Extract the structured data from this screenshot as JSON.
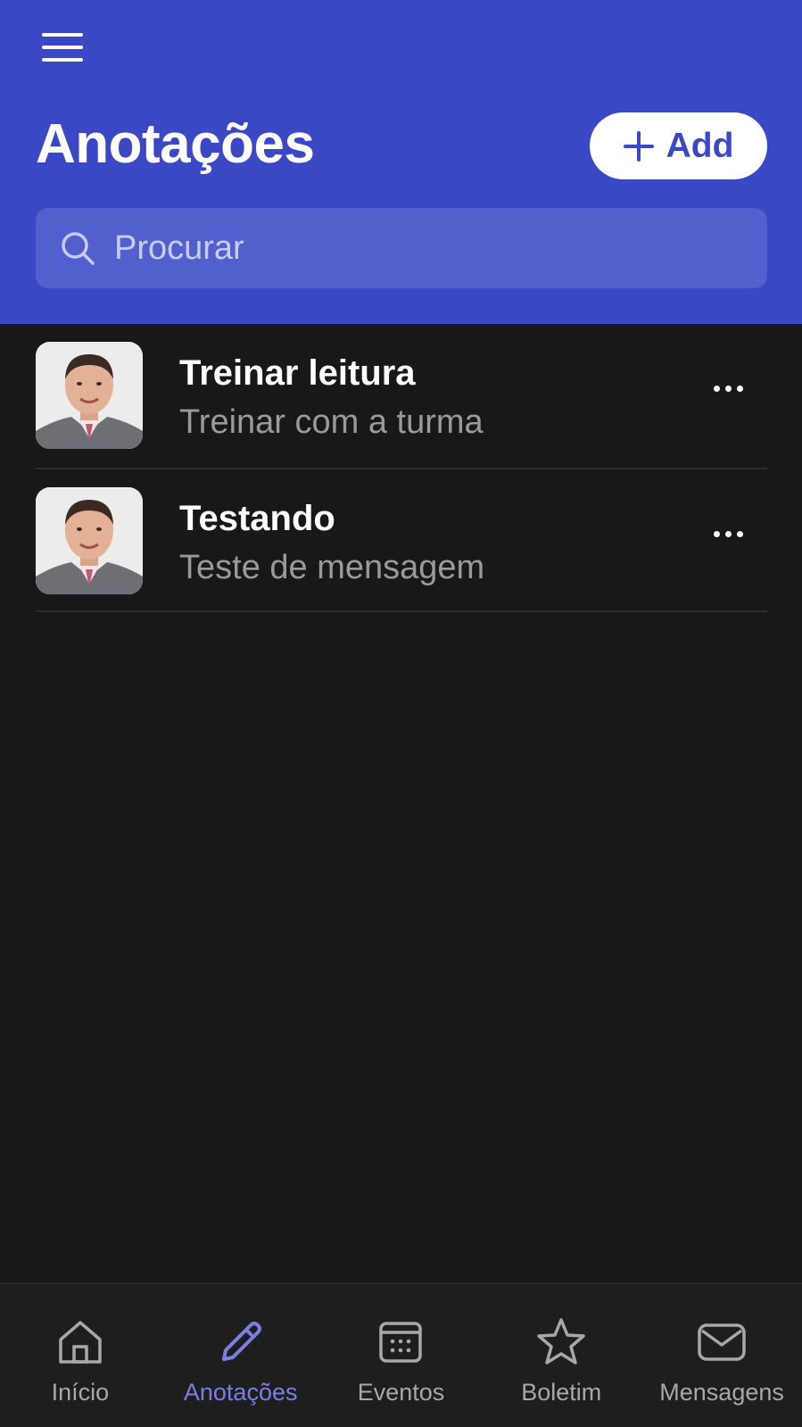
{
  "header": {
    "title": "Anotações",
    "add_label": "Add",
    "menu_icon": "hamburger-menu-icon",
    "accent_color": "#3a48c5"
  },
  "search": {
    "placeholder": "Procurar",
    "value": ""
  },
  "notes": [
    {
      "title": "Treinar leitura",
      "subtitle": "Treinar com a turma"
    },
    {
      "title": "Testando",
      "subtitle": "Teste de mensagem"
    }
  ],
  "bottom_nav": {
    "active": "Anotações",
    "active_color": "#7b7fe4",
    "items": [
      {
        "label": "Início",
        "icon": "home-icon"
      },
      {
        "label": "Anotações",
        "icon": "pencil-icon"
      },
      {
        "label": "Eventos",
        "icon": "calendar-icon"
      },
      {
        "label": "Boletim",
        "icon": "star-icon"
      },
      {
        "label": "Mensagens",
        "icon": "mail-icon"
      }
    ]
  }
}
